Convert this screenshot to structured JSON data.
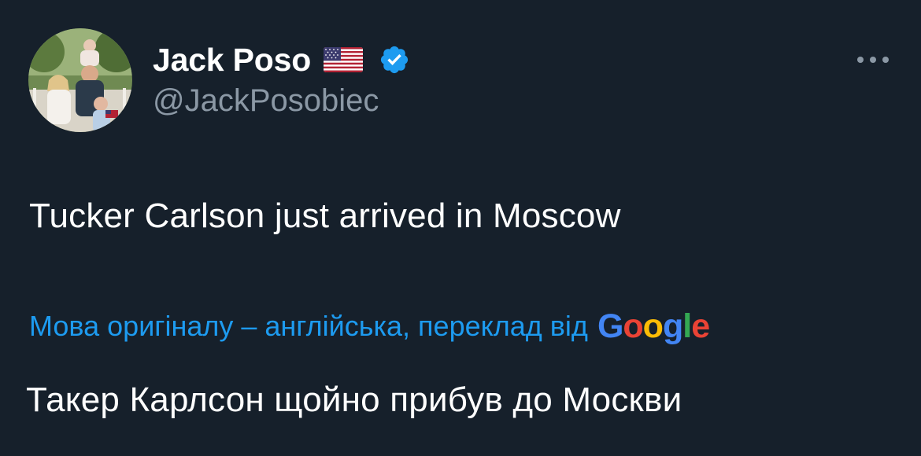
{
  "author": {
    "display_name": "Jack Poso",
    "flag_emoji_icon": "us-flag-icon",
    "verified_icon": "verified-badge-icon",
    "handle": "@JackPosobiec",
    "avatar_icon": "family-photo-avatar"
  },
  "menu": {
    "more_icon": "more-dots-icon"
  },
  "tweet": {
    "text": "Tucker Carlson just arrived in Moscow"
  },
  "translation": {
    "label": "Мова оригіналу – англійська, переклад від",
    "provider_letters": [
      "G",
      "o",
      "o",
      "g",
      "l",
      "e"
    ],
    "provider_colors": [
      "#4285f4",
      "#ea4335",
      "#fbbc05",
      "#4285f4",
      "#34a853",
      "#ea4335"
    ],
    "text": "Такер Карлсон щойно прибув до Москви"
  },
  "colors": {
    "background": "#16202b",
    "primary_text": "#ffffff",
    "secondary_text": "#8b98a5",
    "link_blue": "#1d9bf0",
    "verified_blue": "#1d9bf0"
  }
}
